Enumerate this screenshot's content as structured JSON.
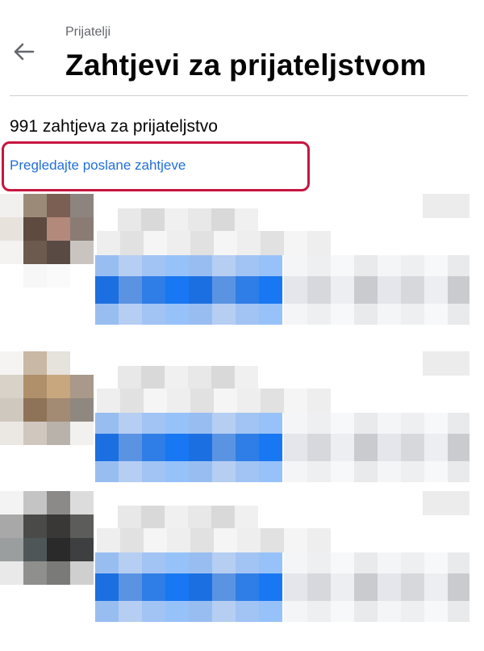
{
  "header": {
    "breadcrumb": "Prijatelji",
    "title": "Zahtjevi za prijateljstvom"
  },
  "requests_count_text": "991 zahtjeva za prijateljstvo",
  "sent_requests_link": "Pregledajte poslane zahtjeve",
  "colors": {
    "link": "#216fdb",
    "highlight": "#c8153f",
    "primary_button": "#1877f2"
  },
  "requests": [
    {
      "avatar_palette": [
        "#f2f0ee",
        "#9c8a78",
        "#7b5f52",
        "#8d8480",
        "#e7e2dc",
        "#5e4a3f",
        "#b3897c",
        "#8a7c74",
        "#f4f3f1",
        "#6d5a4f",
        "#5a4a44",
        "#c9c4c0",
        "#ffffff",
        "#f7f7f7",
        "#fafafa",
        "#ffffff"
      ]
    },
    {
      "avatar_palette": [
        "#f5f4f2",
        "#c9b8a4",
        "#e6e2dc",
        "#ffffff",
        "#d9d2c8",
        "#b08f6b",
        "#c8a77e",
        "#a8998a",
        "#cfc8bf",
        "#8e7358",
        "#a38a73",
        "#8f8880",
        "#ebe8e4",
        "#d0c7be",
        "#b9b2ab",
        "#f2f1ef"
      ]
    },
    {
      "avatar_palette": [
        "#f3f3f3",
        "#c4c4c4",
        "#8c8a88",
        "#dcdcdc",
        "#a8a8a8",
        "#4a4a48",
        "#3a3836",
        "#5c5c5a",
        "#9a9e9f",
        "#4f5658",
        "#2a2a2a",
        "#3d3f40",
        "#e9e9e9",
        "#8f8f8d",
        "#7a7a78",
        "#cfcfcf"
      ]
    }
  ]
}
